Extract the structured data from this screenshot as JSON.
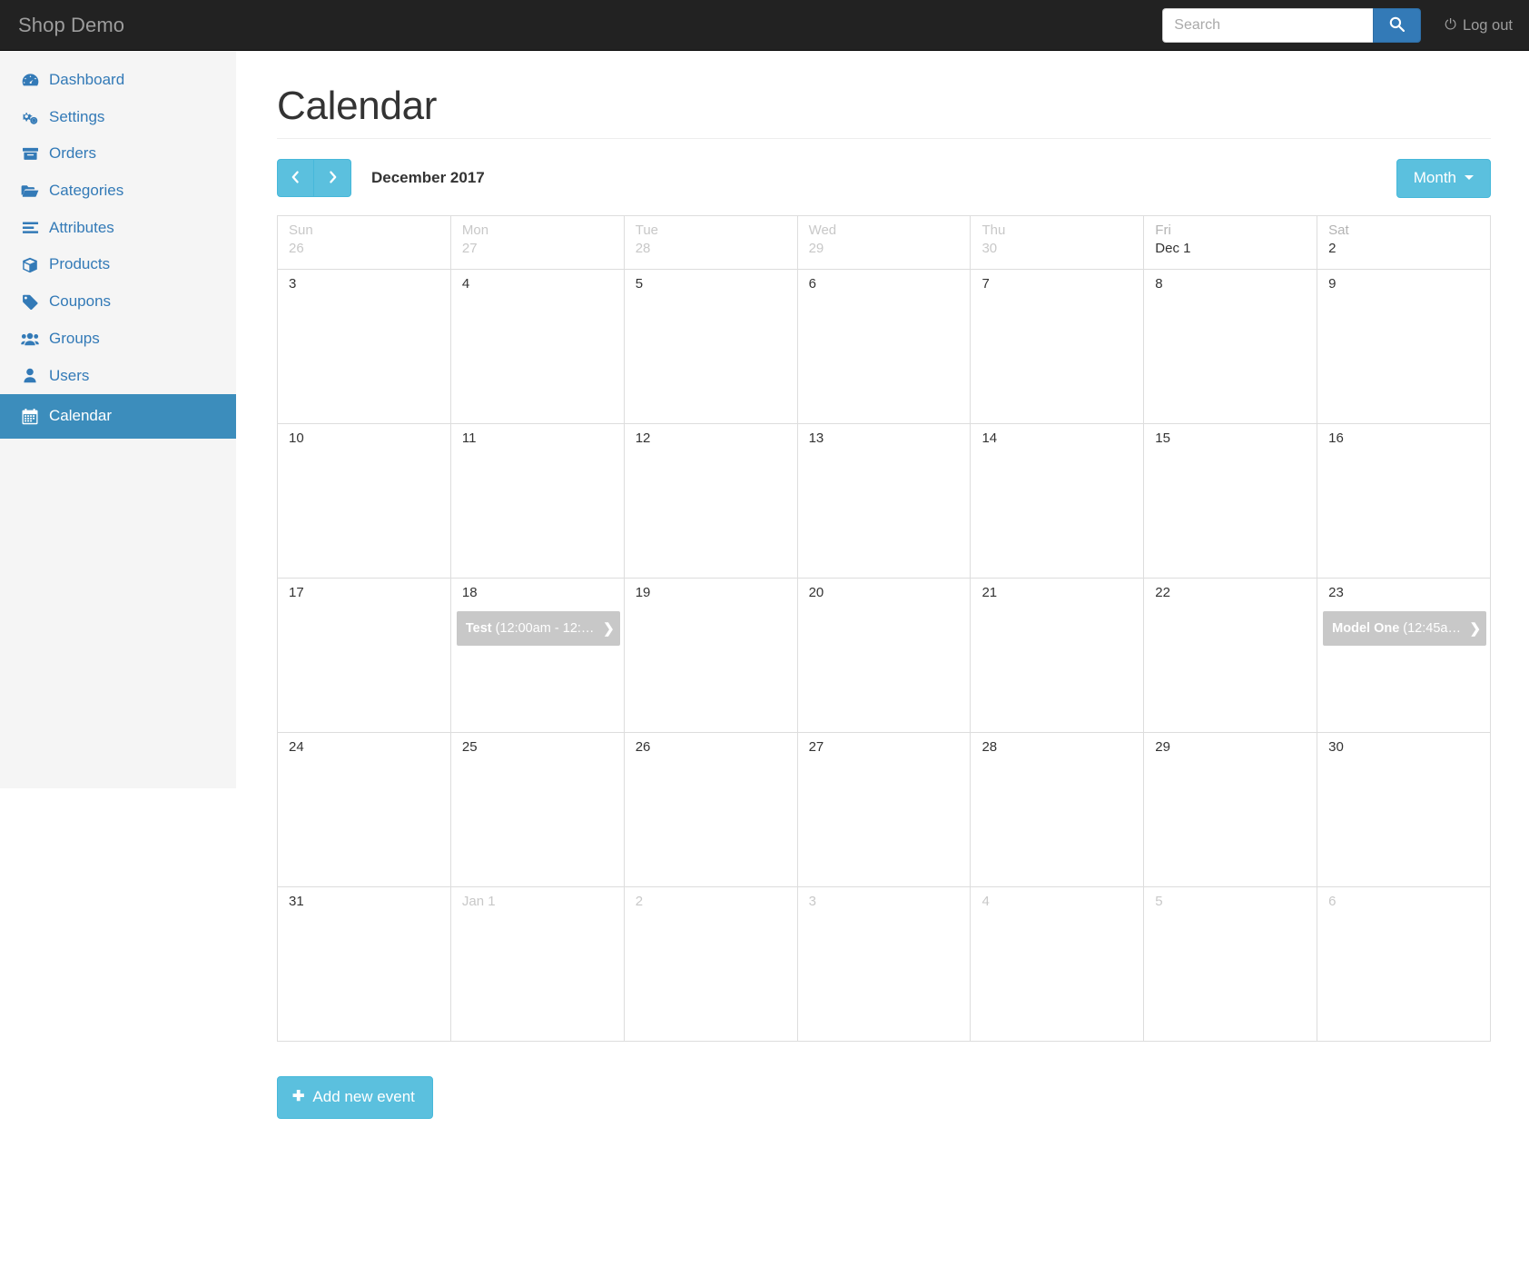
{
  "navbar": {
    "brand": "Shop Demo",
    "search_placeholder": "Search",
    "search_value": "",
    "search_icon": "search-icon",
    "logout_label": "Log out",
    "logout_icon": "power-off-icon"
  },
  "sidebar": {
    "items": [
      {
        "label": "Dashboard",
        "icon": "tachometer-icon",
        "active": false
      },
      {
        "label": "Settings",
        "icon": "cogs-icon",
        "active": false
      },
      {
        "label": "Orders",
        "icon": "archive-icon",
        "active": false
      },
      {
        "label": "Categories",
        "icon": "folder-open-icon",
        "active": false
      },
      {
        "label": "Attributes",
        "icon": "align-left-icon",
        "active": false
      },
      {
        "label": "Products",
        "icon": "cube-icon",
        "active": false
      },
      {
        "label": "Coupons",
        "icon": "tag-icon",
        "active": false
      },
      {
        "label": "Groups",
        "icon": "users-icon",
        "active": false
      },
      {
        "label": "Users",
        "icon": "user-icon",
        "active": false
      },
      {
        "label": "Calendar",
        "icon": "calendar-icon",
        "active": true
      }
    ]
  },
  "main": {
    "page_title": "Calendar",
    "toolbar": {
      "prev_icon": "chevron-left-icon",
      "next_icon": "chevron-right-icon",
      "period_title": "December 2017",
      "view_label": "Month",
      "view_caret_icon": "caret-down-icon"
    },
    "add_event_label": "Add new event",
    "add_event_icon": "plus-icon"
  },
  "calendar": {
    "day_headers": [
      {
        "dow": "Sun",
        "date": "26",
        "muted": true
      },
      {
        "dow": "Mon",
        "date": "27",
        "muted": true
      },
      {
        "dow": "Tue",
        "date": "28",
        "muted": true
      },
      {
        "dow": "Wed",
        "date": "29",
        "muted": true
      },
      {
        "dow": "Thu",
        "date": "30",
        "muted": true
      },
      {
        "dow": "Fri",
        "date": "Dec 1",
        "muted": false
      },
      {
        "dow": "Sat",
        "date": "2",
        "muted": false
      }
    ],
    "weeks": [
      [
        {
          "date": "3",
          "muted": false,
          "events": []
        },
        {
          "date": "4",
          "muted": false,
          "events": []
        },
        {
          "date": "5",
          "muted": false,
          "events": []
        },
        {
          "date": "6",
          "muted": false,
          "events": []
        },
        {
          "date": "7",
          "muted": false,
          "events": []
        },
        {
          "date": "8",
          "muted": false,
          "events": []
        },
        {
          "date": "9",
          "muted": false,
          "events": []
        }
      ],
      [
        {
          "date": "10",
          "muted": false,
          "events": []
        },
        {
          "date": "11",
          "muted": false,
          "events": []
        },
        {
          "date": "12",
          "muted": false,
          "events": []
        },
        {
          "date": "13",
          "muted": false,
          "events": []
        },
        {
          "date": "14",
          "muted": false,
          "events": []
        },
        {
          "date": "15",
          "muted": false,
          "events": []
        },
        {
          "date": "16",
          "muted": false,
          "events": []
        }
      ],
      [
        {
          "date": "17",
          "muted": false,
          "events": []
        },
        {
          "date": "18",
          "muted": false,
          "events": [
            {
              "title": "Test",
              "time": "(12:00am - 12:…",
              "arrow": "❯",
              "color": "#c8c8c8"
            }
          ]
        },
        {
          "date": "19",
          "muted": false,
          "events": []
        },
        {
          "date": "20",
          "muted": false,
          "events": []
        },
        {
          "date": "21",
          "muted": false,
          "events": []
        },
        {
          "date": "22",
          "muted": false,
          "events": []
        },
        {
          "date": "23",
          "muted": false,
          "events": [
            {
              "title": "Model One",
              "time": "(12:45a…",
              "arrow": "❯",
              "color": "#c8c8c8"
            }
          ]
        }
      ],
      [
        {
          "date": "24",
          "muted": false,
          "events": []
        },
        {
          "date": "25",
          "muted": false,
          "events": []
        },
        {
          "date": "26",
          "muted": false,
          "events": []
        },
        {
          "date": "27",
          "muted": false,
          "events": []
        },
        {
          "date": "28",
          "muted": false,
          "events": []
        },
        {
          "date": "29",
          "muted": false,
          "events": []
        },
        {
          "date": "30",
          "muted": false,
          "events": []
        }
      ],
      [
        {
          "date": "31",
          "muted": false,
          "events": []
        },
        {
          "date": "Jan 1",
          "muted": true,
          "events": []
        },
        {
          "date": "2",
          "muted": true,
          "events": []
        },
        {
          "date": "3",
          "muted": true,
          "events": []
        },
        {
          "date": "4",
          "muted": true,
          "events": []
        },
        {
          "date": "5",
          "muted": true,
          "events": []
        },
        {
          "date": "6",
          "muted": true,
          "events": []
        }
      ]
    ]
  },
  "colors": {
    "navbar_bg": "#222222",
    "sidebar_bg": "#f5f5f5",
    "link_blue": "#337ab7",
    "active_blue": "#3c8dbc",
    "info_blue": "#5bc0de",
    "event_gray": "#c8c8c8",
    "grid_border": "#dddddd"
  }
}
